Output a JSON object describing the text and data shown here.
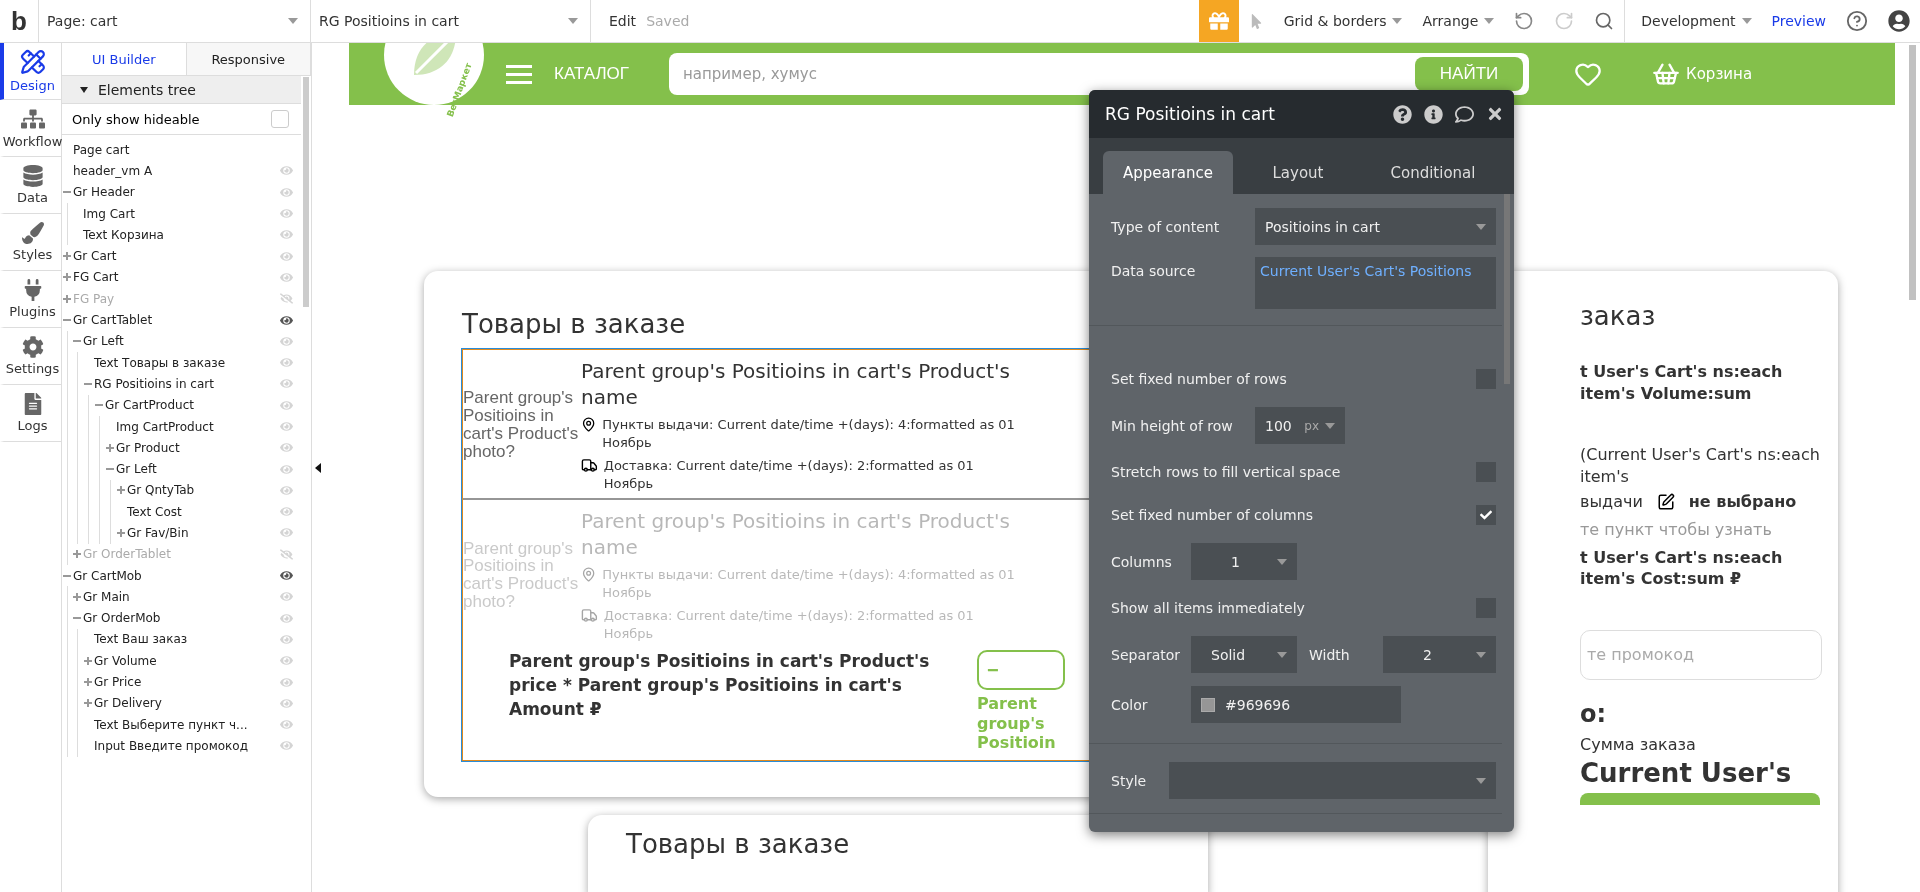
{
  "topbar": {
    "logo": "b",
    "page": "Page: cart",
    "element": "RG Positioins in cart",
    "edit": "Edit",
    "status": "Saved",
    "menus": [
      {
        "label": "Grid & borders"
      },
      {
        "label": "Arrange"
      }
    ],
    "environment": "Development",
    "preview": "Preview"
  },
  "sidebar": {
    "items": [
      {
        "label": "Design",
        "kind": "design",
        "selected": true
      },
      {
        "label": "Workflow",
        "kind": "workflow",
        "selected": false
      },
      {
        "label": "Data",
        "kind": "data",
        "selected": false
      },
      {
        "label": "Styles",
        "kind": "styles",
        "selected": false
      },
      {
        "label": "Plugins",
        "kind": "plugins",
        "selected": false
      },
      {
        "label": "Settings",
        "kind": "settings",
        "selected": false
      },
      {
        "label": "Logs",
        "kind": "logs",
        "selected": false
      }
    ]
  },
  "tree_panel": {
    "tabs": [
      {
        "label": "UI Builder",
        "selected": true
      },
      {
        "label": "Responsive",
        "selected": false
      }
    ],
    "header": "Elements tree",
    "filter": {
      "label": "Only show hideable",
      "checked": false
    },
    "items": [
      {
        "label": "Page cart",
        "kind": "page"
      },
      {
        "label": "header_vm A",
        "kind": "element",
        "hidden": false,
        "highlighted": false
      },
      {
        "label": "Gr Header",
        "kind": "element",
        "hidden": false,
        "highlighted": false,
        "expanded": true,
        "children": [
          {
            "label": "Img Cart",
            "kind": "element",
            "hidden": false,
            "highlighted": false
          },
          {
            "label": "Text Корзина",
            "kind": "element",
            "hidden": false,
            "highlighted": false
          }
        ]
      },
      {
        "label": "Gr Cart",
        "kind": "element",
        "hidden": false,
        "highlighted": false,
        "expanded": false
      },
      {
        "label": "FG Cart",
        "kind": "element",
        "hidden": false,
        "highlighted": false,
        "expanded": false
      },
      {
        "label": "FG Pay",
        "kind": "element",
        "hidden": true,
        "highlighted": false,
        "expanded": false
      },
      {
        "label": "Gr CartTablet",
        "kind": "element",
        "hidden": false,
        "highlighted": true,
        "expanded": true,
        "children": [
          {
            "label": "Gr Left",
            "kind": "element",
            "hidden": false,
            "highlighted": false,
            "expanded": true,
            "children": [
              {
                "label": "Text Товары в заказе",
                "kind": "element",
                "hidden": false,
                "highlighted": false
              },
              {
                "label": "RG Positioins in cart",
                "kind": "element",
                "hidden": false,
                "highlighted": false,
                "expanded": true,
                "children": [
                  {
                    "label": "Gr CartProduct",
                    "kind": "element",
                    "hidden": false,
                    "highlighted": false,
                    "expanded": true,
                    "children": [
                      {
                        "label": "Img CartProduct",
                        "kind": "element",
                        "hidden": false,
                        "highlighted": false
                      },
                      {
                        "label": "Gr Product",
                        "kind": "element",
                        "hidden": false,
                        "highlighted": false,
                        "expanded": false
                      },
                      {
                        "label": "Gr Left",
                        "kind": "element",
                        "hidden": false,
                        "highlighted": false,
                        "expanded": true,
                        "children": [
                          {
                            "label": "Gr QntyTab",
                            "kind": "element",
                            "hidden": false,
                            "highlighted": false,
                            "expanded": false
                          },
                          {
                            "label": "Text Cost",
                            "kind": "element",
                            "hidden": false,
                            "highlighted": false
                          },
                          {
                            "label": "Gr Fav/Bin",
                            "kind": "element",
                            "hidden": false,
                            "highlighted": false,
                            "expanded": false
                          }
                        ]
                      }
                    ]
                  }
                ]
              }
            ]
          },
          {
            "label": "Gr OrderTablet",
            "kind": "element",
            "hidden": true,
            "highlighted": false,
            "expanded": false
          }
        ]
      },
      {
        "label": "Gr CartMob",
        "kind": "element",
        "hidden": false,
        "highlighted": true,
        "expanded": true,
        "children": [
          {
            "label": "Gr Main",
            "kind": "element",
            "hidden": false,
            "highlighted": false,
            "expanded": false
          },
          {
            "label": "Gr OrderMob",
            "kind": "element",
            "hidden": false,
            "highlighted": false,
            "expanded": true,
            "children": [
              {
                "label": "Text Ваш заказ",
                "kind": "element",
                "hidden": false,
                "highlighted": false
              },
              {
                "label": "Gr Volume",
                "kind": "element",
                "hidden": false,
                "highlighted": false,
                "expanded": false
              },
              {
                "label": "Gr Price",
                "kind": "element",
                "hidden": false,
                "highlighted": false,
                "expanded": false
              },
              {
                "label": "Gr Delivery",
                "kind": "element",
                "hidden": false,
                "highlighted": false,
                "expanded": false
              },
              {
                "label": "Text Выберите пункт ч...",
                "kind": "element",
                "hidden": false,
                "highlighted": false
              },
              {
                "label": "Input Введите промокод",
                "kind": "element",
                "hidden": false,
                "highlighted": false
              }
            ]
          }
        ]
      }
    ]
  },
  "canvas": {
    "site_header": {
      "logo_text": "ВегМаркет",
      "catalog": "КАТАЛОГ",
      "search_placeholder": "например, хумус",
      "search_button": "НАЙТИ",
      "cart_label": "Корзина"
    },
    "items_card": {
      "title": "Товары в заказе",
      "rows": [
        {
          "faded": false,
          "photo": "Parent group's Positioins in cart's Product's photo?",
          "name": "Parent group's Positioins in cart's Product's name",
          "pickup": "Пункты выдачи: Current date/time +(days): 4:formatted as 01 Ноябрь",
          "delivery": "Доставка: Current date/time +(days): 2:formatted as 01 Ноябрь"
        },
        {
          "faded": true,
          "photo": "Parent group's Positioins in cart's Product's photo?",
          "name": "Parent group's Positioins in cart's Product's name",
          "pickup": "Пункты выдачи: Current date/time +(days): 4:formatted as 01 Ноябрь",
          "delivery": "Доставка: Current date/time +(days): 2:formatted as 01 Ноябрь"
        }
      ],
      "price": "Parent group's Positioins in cart's Product's price * Parent group's Positioins in cart's Amount ₽",
      "qty_button": "−",
      "qty_text": "Parent group's Positioin"
    },
    "order_card": {
      "title": "заказ",
      "volume": "t User's Cart's ns:each item's Volume:sum",
      "pickup_count": "(Current User's Cart's ns:each item's",
      "pickup_label": "выдачи",
      "pickup_value": "не выбрано",
      "hint": "те пункт чтобы узнать",
      "cost": "t User's Cart's ns:each item's Cost:sum ₽",
      "promo_placeholder": "те промокод",
      "total_title": "о:",
      "sum_label": "Сумма заказа",
      "sum_value": "Current User's"
    },
    "second_card": {
      "title": "Товары в заказе"
    }
  },
  "property_editor": {
    "title": "RG Positioins in cart",
    "tabs": [
      {
        "label": "Appearance",
        "selected": true
      },
      {
        "label": "Layout",
        "selected": false
      },
      {
        "label": "Conditional",
        "selected": false
      }
    ],
    "sections": [
      {
        "fields": [
          {
            "kind": "select",
            "label": "Type of content",
            "value": "Positioins in cart"
          },
          {
            "kind": "expression",
            "label": "Data source",
            "value": "Current User's Cart's Positions"
          }
        ]
      },
      {
        "fields": [
          {
            "kind": "checkbox",
            "label": "Set fixed number of rows",
            "checked": false
          },
          {
            "kind": "number",
            "label": "Min height of row",
            "value": "100",
            "unit": "px"
          },
          {
            "kind": "checkbox",
            "label": "Stretch rows to fill vertical space",
            "checked": false
          },
          {
            "kind": "checkbox",
            "label": "Set fixed number of columns",
            "checked": true
          },
          {
            "kind": "compact_select",
            "label": "Columns",
            "value": "1"
          },
          {
            "kind": "checkbox",
            "label": "Show all items immediately",
            "checked": false
          },
          {
            "kind": "pair",
            "label": "Separator",
            "value": "Solid",
            "label2": "Width",
            "value2": "2"
          },
          {
            "kind": "color",
            "label": "Color",
            "value": "#969696"
          }
        ]
      },
      {
        "fields": [
          {
            "kind": "style_select",
            "label": "Style"
          }
        ]
      }
    ]
  }
}
